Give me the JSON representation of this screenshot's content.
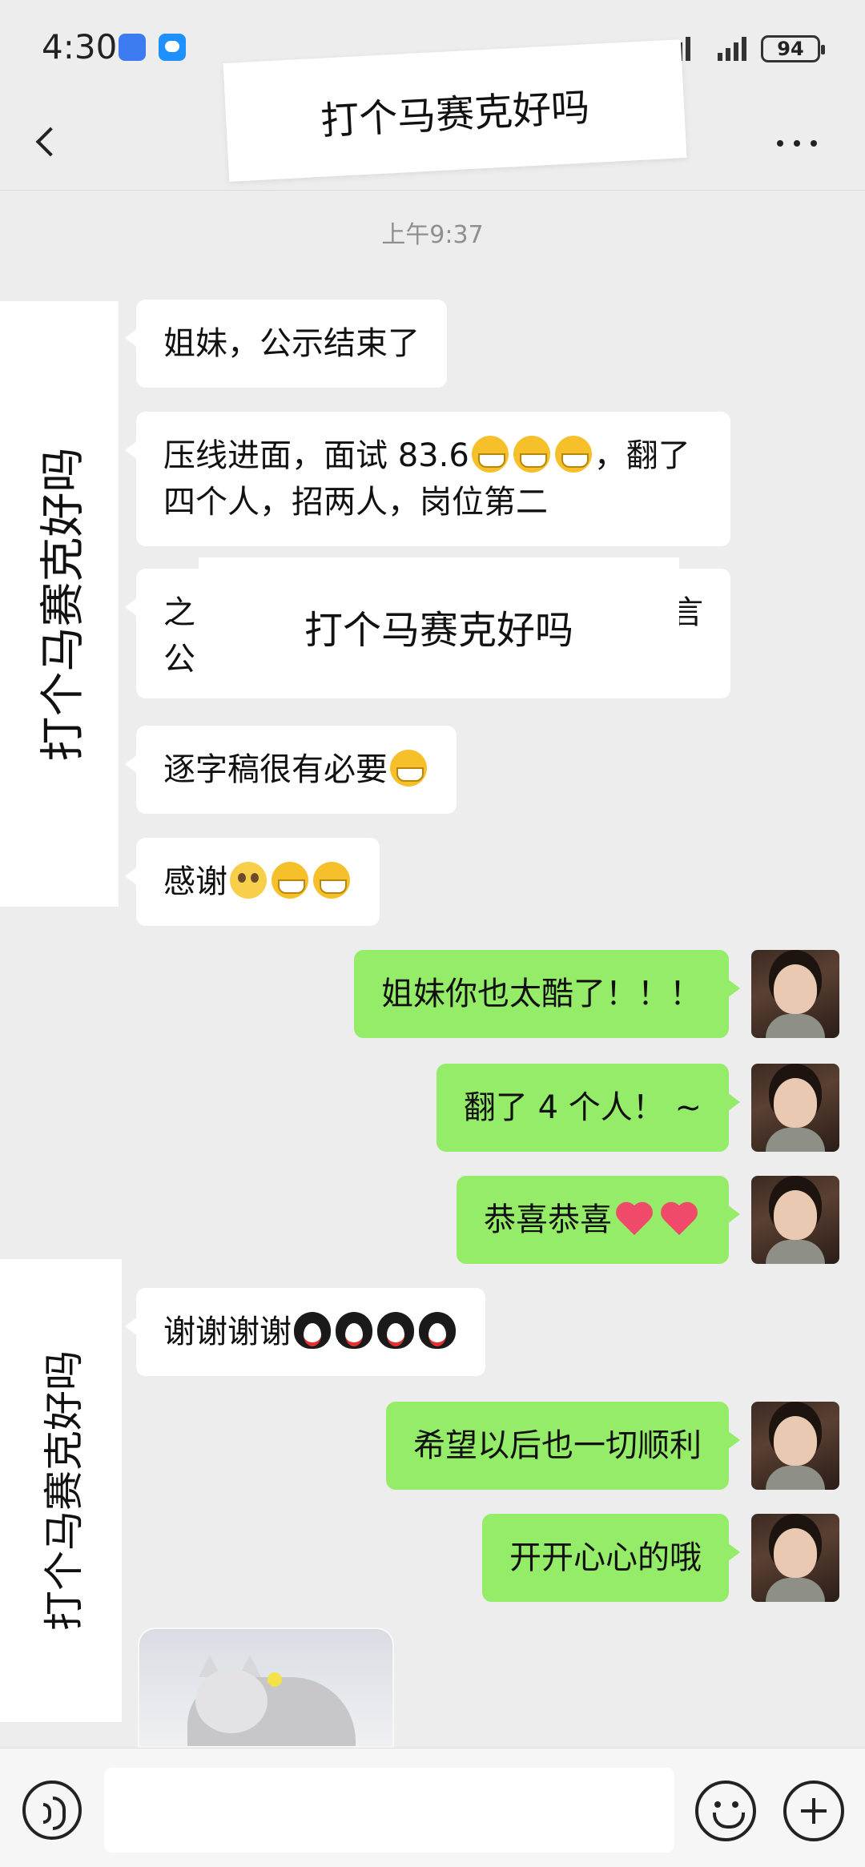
{
  "status_bar": {
    "time": "4:30",
    "battery": "94"
  },
  "nav": {
    "title": "打个马赛克好吗"
  },
  "overlays": {
    "title": "打个马赛克好吗",
    "mid": "打个马赛克好吗",
    "left_1": "打个马赛克好吗",
    "left_2": "打个马赛克好吗"
  },
  "timestamp": "上午9:37",
  "messages": [
    {
      "side": "in",
      "text": "姐妹，公示结束了"
    },
    {
      "side": "in",
      "text": "压线进面，面试 83.6",
      "text2": "，翻了四个人，招两人，岗位第二",
      "emojis": [
        "grin",
        "grin",
        "grin"
      ]
    },
    {
      "side": "in",
      "text": "之",
      "text2": "言",
      "line2": "公",
      "note": "partially covered"
    },
    {
      "side": "in",
      "text": "逐字稿很有必要",
      "emojis": [
        "grin"
      ]
    },
    {
      "side": "in",
      "text": "感谢",
      "emojis": [
        "tear",
        "grin",
        "grin"
      ]
    },
    {
      "side": "out",
      "text": "姐妹你也太酷了！！！"
    },
    {
      "side": "out",
      "text": "翻了 4 个人！ ~"
    },
    {
      "side": "out",
      "text": "恭喜恭喜",
      "emojis": [
        "heart",
        "heart"
      ]
    },
    {
      "side": "in",
      "text": "谢谢谢谢",
      "emojis": [
        "penguin",
        "penguin",
        "penguin",
        "penguin"
      ]
    },
    {
      "side": "out",
      "text": "希望以后也一切顺利"
    },
    {
      "side": "out",
      "text": "开开心心的哦"
    }
  ],
  "icons": {
    "back": "back-chevron-icon",
    "more": "more-dots-icon",
    "voice": "voice-icon",
    "emoji": "emoji-smile-icon",
    "plus": "plus-icon"
  },
  "colors": {
    "outgoing": "#95ec69",
    "incoming": "#ffffff",
    "background": "#ededed"
  }
}
